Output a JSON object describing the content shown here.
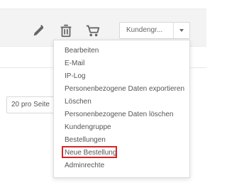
{
  "toolbar": {
    "select": {
      "value": "Kundengr..."
    },
    "icons": {
      "edit": "pencil-icon",
      "delete": "trash-icon",
      "order": "cart-icon"
    }
  },
  "dropdown": {
    "items": [
      {
        "label": "Bearbeiten"
      },
      {
        "label": "E-Mail"
      },
      {
        "label": "IP-Log"
      },
      {
        "label": "Personenbezogene Daten exportieren"
      },
      {
        "label": "Löschen"
      },
      {
        "label": "Personenbezogene Daten löschen"
      },
      {
        "label": "Kundengruppe"
      },
      {
        "label": "Bestellungen"
      },
      {
        "label": "Neue Bestellung",
        "selected": true
      },
      {
        "label": "Adminrechte"
      }
    ]
  },
  "pagination": {
    "per_page_label": "20 pro Seite"
  },
  "colors": {
    "highlight": "#d62525",
    "icon": "#666666"
  }
}
